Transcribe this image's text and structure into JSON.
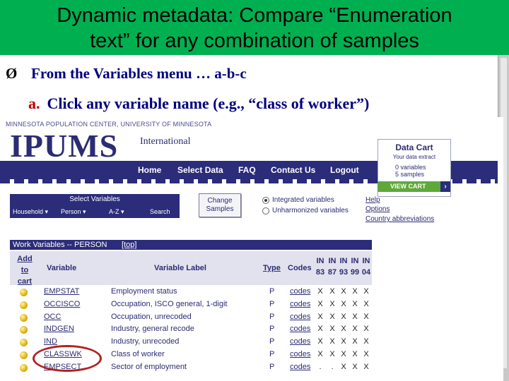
{
  "slide": {
    "title_line1": "Dynamic metadata:  Compare “Enumeration",
    "title_line2": "text” for any combination of samples",
    "bullet_arrow": "Ø",
    "bullet_text": "From the Variables menu … a-b-c",
    "sub_letter": "a.",
    "sub_text": "Click any variable name (e.g., “class of worker”)"
  },
  "site": {
    "institution": "MINNESOTA POPULATION CENTER, UNIVERSITY OF MINNESOTA",
    "logo": "IPUMS",
    "logo_sub": "International",
    "nav": [
      "Home",
      "Select Data",
      "FAQ",
      "Contact Us",
      "Logout"
    ]
  },
  "data_cart": {
    "title": "Data Cart",
    "subtitle": "Your data extract",
    "variables": "0 variables",
    "samples": "5 samples",
    "view_cart": "VIEW CART",
    "chevron": "›"
  },
  "select_variables": {
    "header": "Select Variables",
    "options": [
      "Household ▾",
      "Person ▾",
      "A-Z ▾",
      "Search"
    ]
  },
  "change_samples": {
    "line1": "Change",
    "line2": "Samples"
  },
  "variable_mode": {
    "integrated": "Integrated variables",
    "unharmonized": "Unharmonized variables",
    "selected": "integrated"
  },
  "side_links": [
    "Help",
    "Options",
    "Country abbreviations"
  ],
  "work_variables": {
    "header": "Work Variables -- PERSON",
    "top_link": "[top]",
    "col_add": [
      "Add",
      "to",
      "cart"
    ],
    "col_variable": "Variable",
    "col_label": "Variable Label",
    "col_type": "Type",
    "col_codes": "Codes",
    "col_in": [
      "IN",
      "IN",
      "IN",
      "IN",
      "IN"
    ],
    "col_years": [
      "83",
      "87",
      "93",
      "99",
      "04"
    ],
    "rows": [
      {
        "variable": "EMPSTAT",
        "label": "Employment status",
        "type": "P",
        "codes": "codes",
        "samples": [
          "X",
          "X",
          "X",
          "X",
          "X"
        ]
      },
      {
        "variable": "OCCISCO",
        "label": "Occupation, ISCO general, 1-digit",
        "type": "P",
        "codes": "codes",
        "samples": [
          "X",
          "X",
          "X",
          "X",
          "X"
        ]
      },
      {
        "variable": "OCC",
        "label": "Occupation, unrecoded",
        "type": "P",
        "codes": "codes",
        "samples": [
          "X",
          "X",
          "X",
          "X",
          "X"
        ]
      },
      {
        "variable": "INDGEN",
        "label": "Industry, general recode",
        "type": "P",
        "codes": "codes",
        "samples": [
          "X",
          "X",
          "X",
          "X",
          "X"
        ]
      },
      {
        "variable": "IND",
        "label": "Industry, unrecoded",
        "type": "P",
        "codes": "codes",
        "samples": [
          "X",
          "X",
          "X",
          "X",
          "X"
        ]
      },
      {
        "variable": "CLASSWK",
        "label": "Class of worker",
        "type": "P",
        "codes": "codes",
        "samples": [
          "X",
          "X",
          "X",
          "X",
          "X"
        ]
      },
      {
        "variable": "EMPSECT",
        "label": "Sector of employment",
        "type": "P",
        "codes": "codes",
        "samples": [
          ".",
          ".",
          "X",
          "X",
          "X"
        ]
      }
    ]
  }
}
